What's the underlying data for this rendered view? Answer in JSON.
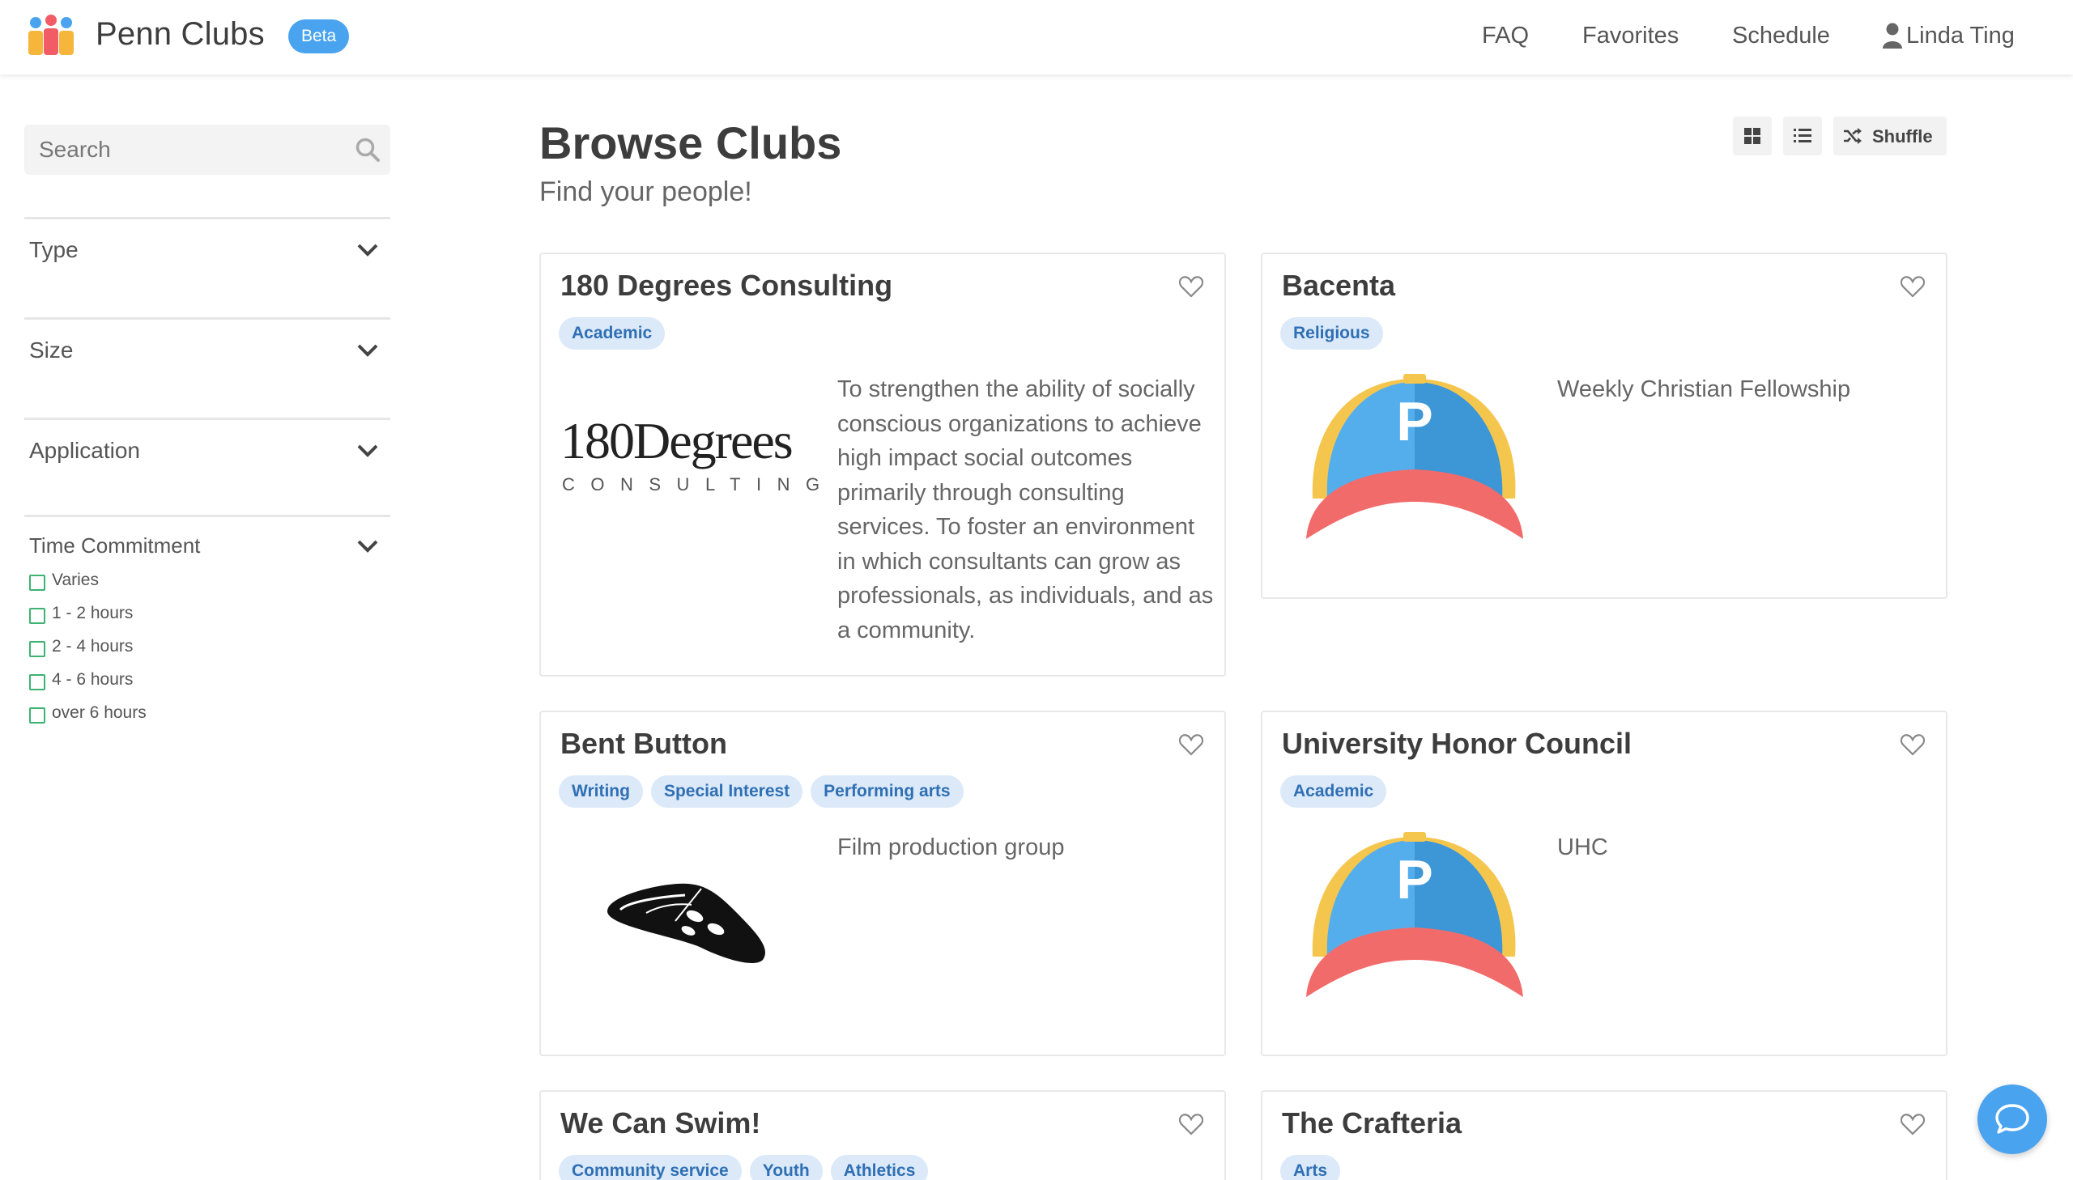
{
  "header": {
    "brand": "Penn Clubs",
    "badge": "Beta",
    "nav": [
      "FAQ",
      "Favorites",
      "Schedule"
    ],
    "user": "Linda Ting"
  },
  "sidebar": {
    "search_placeholder": "Search",
    "filters": [
      {
        "title": "Type"
      },
      {
        "title": "Size"
      },
      {
        "title": "Application"
      },
      {
        "title": "Time Commitment",
        "options": [
          "Varies",
          "1 - 2 hours",
          "2 - 4 hours",
          "4 - 6 hours",
          "over 6 hours"
        ]
      }
    ]
  },
  "main": {
    "title": "Browse Clubs",
    "subtitle": "Find your people!",
    "shuffle_label": "Shuffle",
    "clubs": [
      {
        "name": "180 Degrees Consulting",
        "tags": [
          "Academic"
        ],
        "description": "To strengthen the ability of socially conscious organizations to achieve high impact social outcomes primarily through consulting services. To foster an environment in which consultants can grow as professionals, as individuals, and as a community.",
        "logo": "180-degrees-logo",
        "logo_text": "180Degrees",
        "logo_subtext": "CONSULTING"
      },
      {
        "name": "Bacenta",
        "tags": [
          "Religious"
        ],
        "description": "Weekly Christian Fellowship",
        "logo": "penn-cap-logo"
      },
      {
        "name": "Bent Button",
        "tags": [
          "Writing",
          "Special Interest",
          "Performing arts"
        ],
        "description": "Film production group",
        "logo": "bent-button-logo"
      },
      {
        "name": "University Honor Council",
        "tags": [
          "Academic"
        ],
        "description": "UHC",
        "logo": "penn-cap-logo"
      },
      {
        "name": "We Can Swim!",
        "tags": [
          "Community service",
          "Youth",
          "Athletics"
        ],
        "description": "",
        "logo": ""
      },
      {
        "name": "The Crafteria",
        "tags": [
          "Arts"
        ],
        "description": "",
        "logo": ""
      }
    ]
  },
  "colors": {
    "accent": "#4aa3ee",
    "tag_bg": "#dbe9f9",
    "tag_text": "#2f6fb3",
    "checkbox": "#3cb371"
  }
}
